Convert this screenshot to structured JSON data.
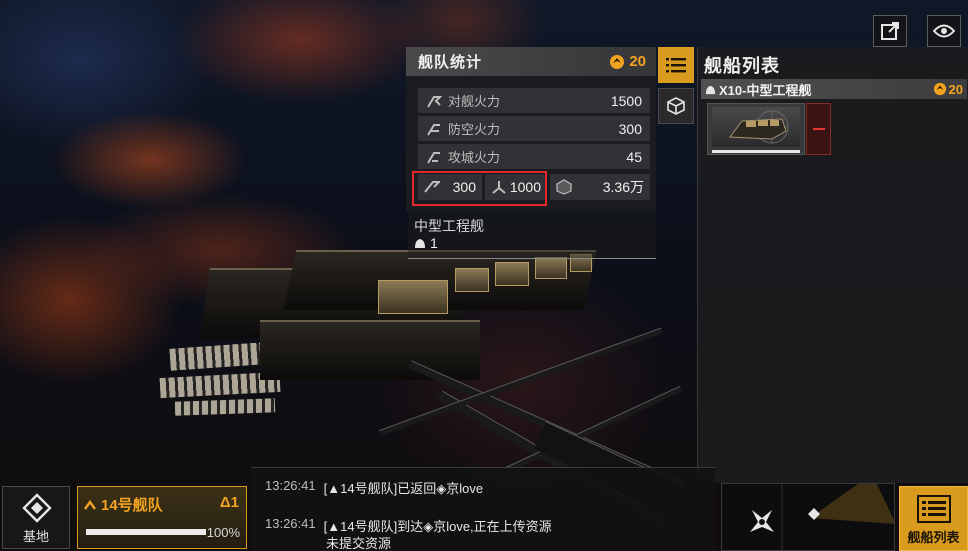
{
  "colors": {
    "accent": "#f2a320",
    "highlight": "#e4272a",
    "remove": "#e2372e"
  },
  "top_buttons": [
    {
      "icon": "external-link-icon"
    },
    {
      "icon": "eye-icon"
    }
  ],
  "stats_panel": {
    "title": "舰队统计",
    "ship_count": "20",
    "rows": [
      {
        "icon": "anti-ship-firepower-icon",
        "label": "对舰火力",
        "value": "1500"
      },
      {
        "icon": "anti-air-firepower-icon",
        "label": "防空火力",
        "value": "300"
      },
      {
        "icon": "siege-firepower-icon",
        "label": "攻城火力",
        "value": "45"
      }
    ],
    "summary": {
      "speed": "300",
      "capacity": "1000",
      "cargo": "3.36万"
    },
    "ship_type": {
      "name": "中型工程舰",
      "count": "1"
    }
  },
  "side_tabs": [
    {
      "icon": "list-icon",
      "active": true
    },
    {
      "icon": "cube-icon",
      "active": false
    }
  ],
  "ship_list": {
    "title": "舰船列表",
    "group_name": "X10-中型工程舰",
    "group_count": "20",
    "ship_hp": 1.0
  },
  "bottom": {
    "base_label": "基地",
    "fleet_name": "14号舰队",
    "fleet_count": "1",
    "fleet_hp_pct": "100%",
    "fleet_hp": 1.0,
    "log": [
      {
        "time": "13:26:41",
        "prefix": "[",
        "fleet": "14号舰队]",
        "text": "已返回",
        "target": "京love",
        "sub": ""
      },
      {
        "time": "13:26:41",
        "prefix": "[",
        "fleet": "14号舰队]",
        "text": "到达",
        "target": "京love,正在上传资源",
        "sub": "未提交资源"
      }
    ],
    "list_button_label": "舰船列表"
  }
}
